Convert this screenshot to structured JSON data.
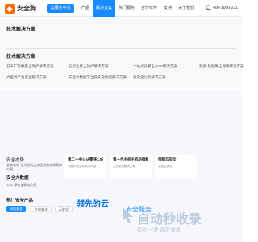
{
  "header": {
    "logo_text": "安全狗",
    "console_label": "云服务中心",
    "nav": [
      {
        "label": "产品"
      },
      {
        "label": "解决方案"
      },
      {
        "label": "热门服务"
      },
      {
        "label": "合作伙伴"
      },
      {
        "label": "支持"
      },
      {
        "label": "关于我们"
      }
    ],
    "phone": "400-1000-221"
  },
  "dropdown": {
    "category": "技术解决方案",
    "section_title": "技术解决方案",
    "items": [
      "云工厂防载安全保护解决方案",
      "云原生安全防护解决方案",
      "一站式云安全SAM解决方案",
      "数据·数据安全保障解决方案",
      "大型云平台安全解决方案",
      "安全大数据平台云安全数据解决方案",
      "云安全分析解决方案",
      ""
    ]
  },
  "content": {
    "hero_label": "安全态势",
    "hero_desc": "态势感知·全方位的云安全态势感知解决方案",
    "cards": [
      {
        "title": "第二十中公从零链2.0安全解决方案",
        "sub": "全面识别主机风险问题"
      },
      {
        "title": "第一代主机主机防御能力安全解决方案",
        "sub": "主机安全解决方案"
      },
      {
        "title": "保障云安全",
        "sub": "云原生安全"
      }
    ],
    "row1_label": "安全大数据",
    "row1_text": "SDP 零信任解决方案",
    "row2_label": "热门安全产品",
    "tabs": [
      {
        "label": "网站安全"
      },
      {
        "label": "主机安全"
      },
      {
        "label": "云安全"
      }
    ],
    "tagline": "领先的云",
    "tagline2": "安全服务"
  },
  "watermark": {
    "text": "自动秒收录",
    "sub": "智能·一键·自动·收录"
  }
}
